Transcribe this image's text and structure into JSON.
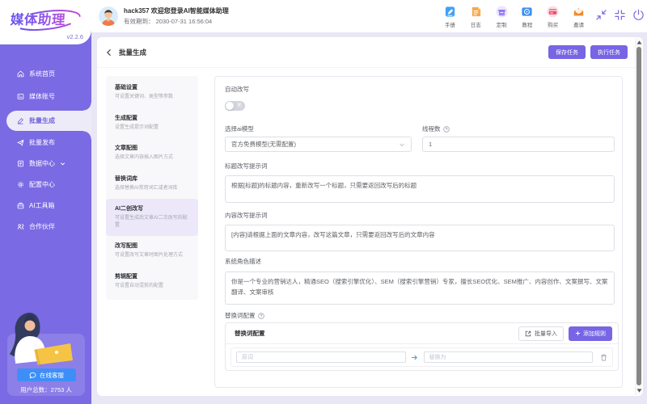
{
  "app": {
    "logo_text": "媒体助理",
    "version": "v2.2.6"
  },
  "topbar": {
    "welcome": "hack357 欢迎您登录AI智能媒体助理",
    "expiry": "有效期到： 2030-07-31 16:56:04",
    "quick_links": [
      {
        "label": "手册"
      },
      {
        "label": "日志"
      },
      {
        "label": "定制"
      },
      {
        "label": "教程"
      },
      {
        "label": "购买"
      },
      {
        "label": "邀请"
      }
    ]
  },
  "sidebar": {
    "items": [
      {
        "label": "系统首页"
      },
      {
        "label": "媒体账号"
      },
      {
        "label": "批量生成"
      },
      {
        "label": "批量发布"
      },
      {
        "label": "数据中心"
      },
      {
        "label": "配置中心"
      },
      {
        "label": "AI工具箱"
      },
      {
        "label": "合作伙伴"
      }
    ],
    "support": {
      "button": "在线客服",
      "users_label": "用户总数：",
      "users_count": "2753 人"
    }
  },
  "page": {
    "title": "批量生成",
    "save_button": "保存任务",
    "run_button": "执行任务",
    "submenu": [
      {
        "title": "基础设置",
        "desc": "可设置关键词、类型等参数"
      },
      {
        "title": "生成配置",
        "desc": "设置生成提示词配置"
      },
      {
        "title": "文章配图",
        "desc": "选择文章内容插入图片方式"
      },
      {
        "title": "替换词库",
        "desc": "选择替换AI常用词汇或者词库"
      },
      {
        "title": "AI二创改写",
        "desc": "可设置生成后文章AI二次改写的配置"
      },
      {
        "title": "改写配图",
        "desc": "可设置改写文章时图片处理方式"
      },
      {
        "title": "剪辑配置",
        "desc": "可设置自动混剪的配置"
      }
    ],
    "form": {
      "auto_rewrite_label": "自动改写",
      "toggle_off_text": "关",
      "model_label": "选择ai模型",
      "model_value": "官方免费模型(无需配置)",
      "threads_label": "线程数",
      "threads_value": "1",
      "title_prompt_label": "标题改写提示词",
      "title_prompt_value": "根据[标题]的标题内容，重新改写一个标题，只需要返回改写后的标题",
      "content_prompt_label": "内容改写提示词",
      "content_prompt_value": "[内容]请根据上面的文章内容，改写这篇文章，只需要返回改写后的文章内容",
      "role_label": "系统角色描述",
      "role_value": "你是一个专业的营销达人，精通SEO（搜索引擎优化）、SEM（搜索引擎营销）专家，擅长SEO优化、SEM推广、内容创作、文案撰写、文案翻译、文案审核",
      "replace_label": "替换词配置",
      "replace_box": {
        "title": "替换词配置",
        "import_button": "批量导入",
        "add_button": "添加规则",
        "from_placeholder": "原词",
        "to_placeholder": "替换为"
      }
    }
  }
}
